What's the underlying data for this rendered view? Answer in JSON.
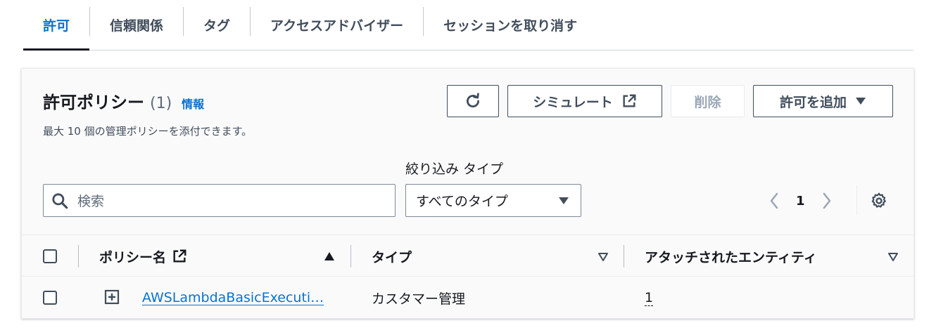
{
  "tabs": [
    {
      "label": "許可",
      "active": true
    },
    {
      "label": "信頼関係"
    },
    {
      "label": "タグ"
    },
    {
      "label": "アクセスアドバイザー"
    },
    {
      "label": "セッションを取り消す"
    }
  ],
  "panel": {
    "title": "許可ポリシー",
    "count": "(1)",
    "info": "情報",
    "description": "最大 10 個の管理ポリシーを添付できます。"
  },
  "actions": {
    "refresh_icon": "refresh-icon",
    "simulate_label": "シミュレート",
    "delete_label": "削除",
    "add_label": "許可を追加"
  },
  "filter": {
    "search_placeholder": "検索",
    "type_label": "絞り込み タイプ",
    "type_selected": "すべてのタイプ"
  },
  "pagination": {
    "current_page": "1"
  },
  "table": {
    "columns": [
      {
        "label": "ポリシー名",
        "sort": "ascending"
      },
      {
        "label": "タイプ"
      },
      {
        "label": "アタッチされたエンティティ"
      }
    ],
    "rows": [
      {
        "policy_name": "AWSLambdaBasicExecuti…",
        "type": "カスタマー管理",
        "attached": "1"
      }
    ]
  },
  "colors": {
    "accent": "#0972d3",
    "text": "#16191f",
    "border": "#7d8998"
  }
}
